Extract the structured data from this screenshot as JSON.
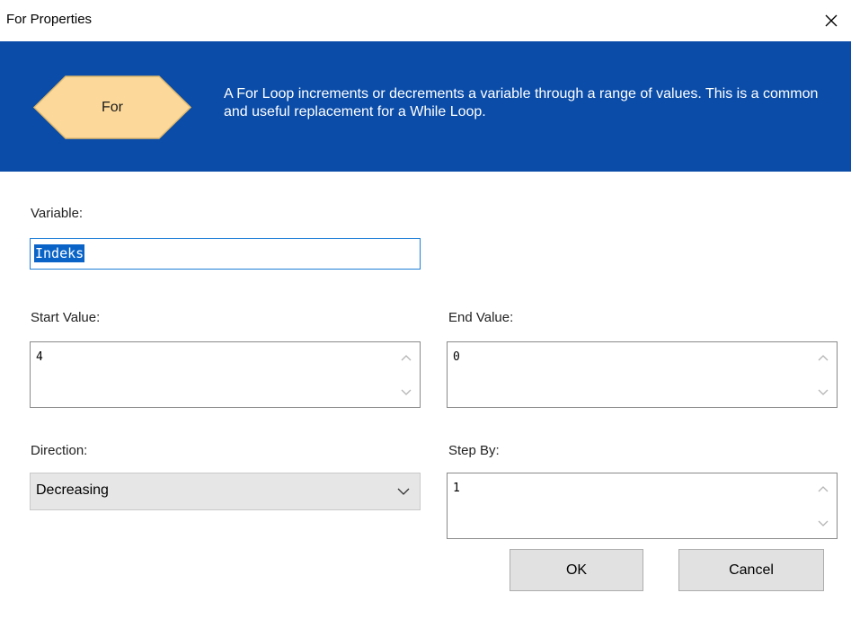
{
  "window": {
    "title": "For Properties"
  },
  "banner": {
    "shape_label": "For",
    "description": "A For Loop increments or decrements a variable through a range of values. This is a common and useful replacement for a While Loop.",
    "colors": {
      "background": "#0a4ca8",
      "shape_fill": "#fcd99a",
      "shape_stroke": "#e0b86a"
    }
  },
  "form": {
    "variable": {
      "label": "Variable:",
      "value": "Indeks"
    },
    "start_value": {
      "label": "Start Value:",
      "value": "4"
    },
    "end_value": {
      "label": "End Value:",
      "value": "0"
    },
    "direction": {
      "label": "Direction:",
      "selected": "Decreasing"
    },
    "step_by": {
      "label": "Step By:",
      "value": "1"
    }
  },
  "buttons": {
    "ok": "OK",
    "cancel": "Cancel"
  },
  "icons": {
    "close": "close-icon",
    "scroll_up": "chevron-up-icon",
    "scroll_down": "chevron-down-icon",
    "dropdown": "chevron-down-icon"
  }
}
